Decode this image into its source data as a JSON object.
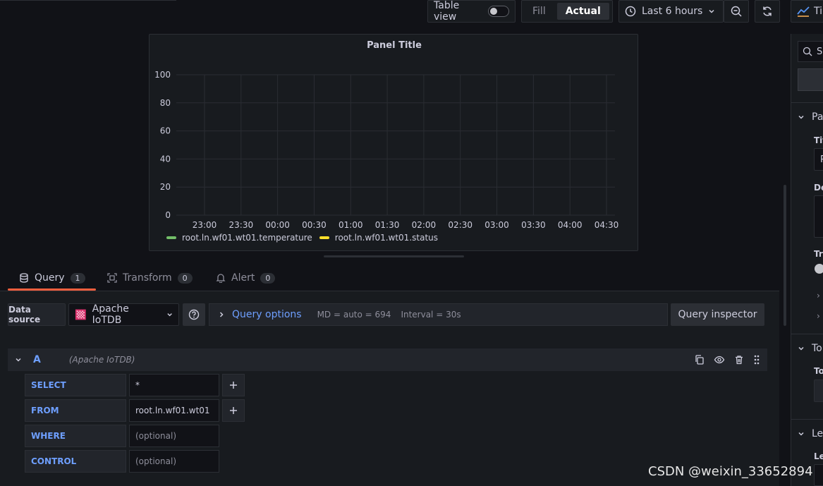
{
  "toolbar": {
    "table_view_label": "Table view",
    "table_view_on": false,
    "fill_label": "Fill",
    "actual_label": "Actual",
    "time_range_label": "Last 6 hours",
    "viz_label": "Ti"
  },
  "panel": {
    "title": "Panel Title"
  },
  "chart_data": {
    "type": "line",
    "title": "Panel Title",
    "x_ticks": [
      "23:00",
      "23:30",
      "00:00",
      "00:30",
      "01:00",
      "01:30",
      "02:00",
      "02:30",
      "03:00",
      "03:30",
      "04:00",
      "04:30"
    ],
    "y_ticks": [
      "0",
      "20",
      "40",
      "60",
      "80",
      "100"
    ],
    "ylim": [
      0,
      100
    ],
    "grid": true,
    "legend_position": "bottom-left",
    "series": [
      {
        "name": "root.ln.wf01.wt01.temperature",
        "color": "#73bf69",
        "values": []
      },
      {
        "name": "root.ln.wf01.wt01.status",
        "color": "#fade2a",
        "values": []
      }
    ]
  },
  "tabs": [
    {
      "label": "Query",
      "count": "1",
      "icon": "database-icon"
    },
    {
      "label": "Transform",
      "count": "0",
      "icon": "transform-icon"
    },
    {
      "label": "Alert",
      "count": "0",
      "icon": "bell-icon"
    }
  ],
  "datasource": {
    "label": "Data source",
    "name": "Apache IoTDB",
    "query_options_label": "Query options",
    "md": "MD = auto = 694",
    "interval": "Interval = 30s",
    "inspector_label": "Query inspector"
  },
  "query": {
    "letter": "A",
    "datasource_hint": "(Apache IoTDB)",
    "rows": [
      {
        "label": "SELECT",
        "value": "*",
        "placeholder": false,
        "has_add": true
      },
      {
        "label": "FROM",
        "value": "root.ln.wf01.wt01",
        "placeholder": false,
        "has_add": true
      },
      {
        "label": "WHERE",
        "value": "(optional)",
        "placeholder": true,
        "has_add": false
      },
      {
        "label": "CONTROL",
        "value": "(optional)",
        "placeholder": true,
        "has_add": false
      }
    ]
  },
  "options_pane": {
    "search_text": "S",
    "sections": [
      {
        "label": "Pa"
      },
      {
        "label": "To"
      },
      {
        "label": "Le"
      }
    ],
    "fields": {
      "title_label": "Tit",
      "title_value": "P",
      "desc_label": "De",
      "transparent_label": "Tra",
      "tooltip_label": "To",
      "legend_label": "Le"
    }
  },
  "watermark": "CSDN @weixin_33652894",
  "colors": {
    "accent": "#f55f3e",
    "blue": "#6e9fff",
    "bg": "#111217",
    "panel": "#181b1f"
  }
}
